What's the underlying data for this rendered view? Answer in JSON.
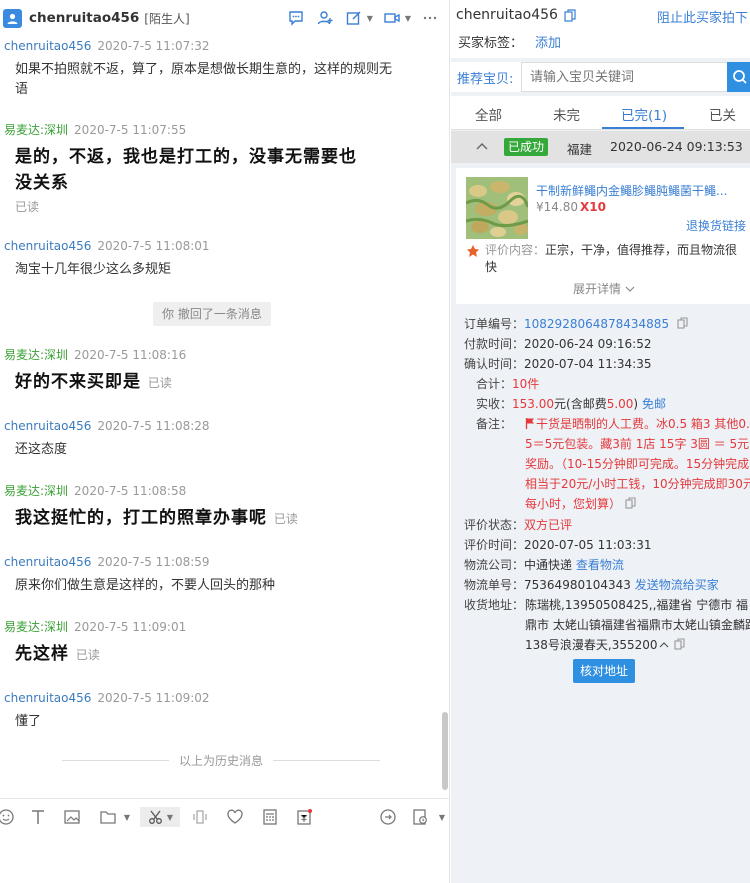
{
  "chat": {
    "title": "chenruitao456",
    "tag": "[陌生人]",
    "recall_note": "你 撤回了一条消息",
    "history_divider": "以上为历史消息",
    "messages": [
      {
        "nick": "chenruitao456",
        "time": "2020-7-5 11:07:32",
        "text": "如果不拍照就不返，算了，原本是想做长期生意的，这样的规则无语"
      },
      {
        "nick": "易麦达:深圳",
        "time": "2020-7-5 11:07:55",
        "text": "是的，不返，我也是打工的，没事无需要也没关系",
        "read": "已读"
      },
      {
        "nick": "chenruitao456",
        "time": "2020-7-5 11:08:01",
        "text": "淘宝十几年很少这么多规矩"
      },
      {
        "nick": "易麦达:深圳",
        "time": "2020-7-5 11:08:16",
        "text": "好的不来买即是",
        "read": "已读"
      },
      {
        "nick": "chenruitao456",
        "time": "2020-7-5 11:08:28",
        "text": "还这态度"
      },
      {
        "nick": "易麦达:深圳",
        "time": "2020-7-5 11:08:58",
        "text": "我这挺忙的，打工的照章办事呢",
        "read": "已读"
      },
      {
        "nick": "chenruitao456",
        "time": "2020-7-5 11:08:59",
        "text": "原来你们做生意是这样的，不要人回头的那种"
      },
      {
        "nick": "易麦达:深圳",
        "time": "2020-7-5 11:09:01",
        "text": "先这样",
        "read": "已读"
      },
      {
        "nick": "chenruitao456",
        "time": "2020-7-5 11:09:02",
        "text": "懂了"
      }
    ]
  },
  "buyer": {
    "name": "chenruitao456",
    "block_link": "阻止此买家拍下",
    "tag_label": "买家标签：",
    "tag_add": "添加"
  },
  "recommend": {
    "label": "推荐宝贝:",
    "placeholder": "请输入宝贝关键词"
  },
  "tabs": [
    "全部",
    "未完",
    "已完(1)",
    "已关"
  ],
  "order": {
    "status": "已成功",
    "region": "福建",
    "datetime": "2020-06-24 09:13:53",
    "item_title": "干制新鲜鱦内金鱦胗鱦肫鱦菌干鱦...",
    "item_price": "¥14.80",
    "item_qty": "X10",
    "refund_link": "退换货链接",
    "review_label": "评价内容：",
    "review_text": "正宗，干净，值得推荐，而且物流很快",
    "expand": "展开详情",
    "order_no_label": "订单编号：",
    "order_no": "1082928064878434885",
    "pay_time_label": "付款时间：",
    "pay_time": "2020-06-24 09:16:52",
    "confirm_time_label": "确认时间：",
    "confirm_time": "2020-07-04 11:34:35",
    "total_label": "合计：",
    "total_qty": "10",
    "total_unit": "件",
    "paid_label": "实收：",
    "paid_amount": "153.00",
    "paid_unit": "元",
    "paid_shipping_pre": "(含邮费",
    "paid_shipping": "5.00",
    "paid_shipping_post": ")",
    "free_shipping": "免邮",
    "note_label": "备注：",
    "note": "干货是晒制的人工费。冰0.5 箱3 其他0.5＝5元包装。藏3前 1店 15字 3圆 ＝ 5元奖励。（10-15分钟即可完成。15分钟完成相当于20元/小时工钱，10分钟完成即30元每小时，您划算）",
    "rate_status_label": "评价状态：",
    "rate_status": "双方已评",
    "rate_time_label": "评价时间：",
    "rate_time": "2020-07-05 11:03:31",
    "logistics_label": "物流公司：",
    "logistics": "中通快递",
    "logistics_link": "查看物流",
    "tracking_label": "物流单号：",
    "tracking": "75364980104343",
    "tracking_link": "发送物流给买家",
    "address_label": "收货地址：",
    "address": "陈瑞桃,13950508425,,福建省 宁德市 福鼎市 太姥山镇福建省福鼎市太姥山镇金麟路138号浪漫春天,355200",
    "verify_button": "核对地址"
  },
  "colors": {
    "link_blue": "#3a7fd5",
    "seller_green": "#3aa035",
    "success_green": "#35a83a",
    "alert_red": "#e4393c",
    "button_blue": "#2f8fe0"
  }
}
